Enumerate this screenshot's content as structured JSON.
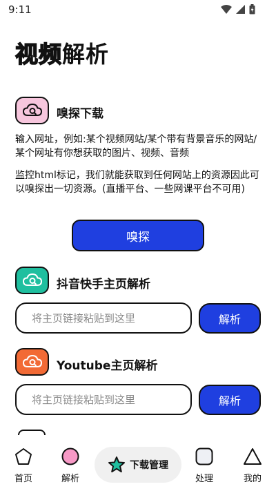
{
  "status_bar": {
    "time": "9:11"
  },
  "page_title": {
    "outlined": "视频",
    "solid": "解析"
  },
  "sniff_card": {
    "title": "嗅探下载",
    "desc1": "输入网址，例如:某个视频网站/某个带有背景音乐的网站/某个网址有你想获取的图片、视频、音频",
    "desc2": "监控html标记，我们就能获取到任何网站上的资源因此可以嗅探出一切资源。(直播平台、一些网课平台不可用)",
    "button": "嗅探",
    "icon_color": "#f7c6dd"
  },
  "douyin_card": {
    "title": "抖音快手主页解析",
    "placeholder": "将主页链接粘贴到这里",
    "button": "解析",
    "icon_color": "#1fbf9f"
  },
  "youtube_card": {
    "title": "Youtube主页解析",
    "placeholder": "将主页链接粘贴到这里",
    "button": "解析",
    "icon_color": "#f26a35"
  },
  "bottom_nav": {
    "home": "首页",
    "parse": "解析",
    "downloads": "下载管理",
    "process": "处理",
    "mine": "我的"
  },
  "colors": {
    "accent": "#1f3fe0",
    "parse_nav_icon": "#f799c6",
    "downloads_star": "#1fbf9f"
  }
}
